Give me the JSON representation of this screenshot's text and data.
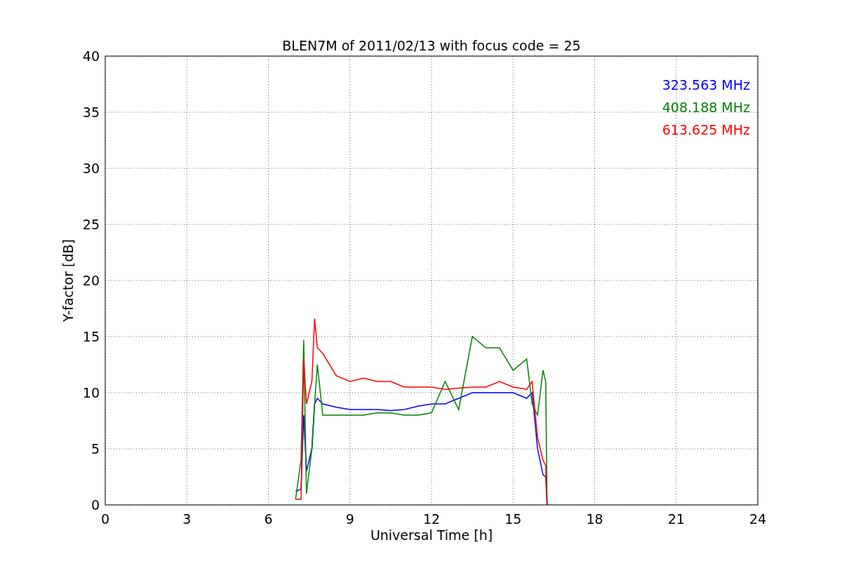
{
  "chart_data": {
    "type": "line",
    "title": "BLEN7M of 2011/02/13 with focus code = 25",
    "xlabel": "Universal Time [h]",
    "ylabel": "Y-factor [dB]",
    "x": [
      7.0,
      7.2,
      7.3,
      7.4,
      7.6,
      7.7,
      7.8,
      8.0,
      8.5,
      9.0,
      9.5,
      10.0,
      10.5,
      11.0,
      11.5,
      12.0,
      12.5,
      13.0,
      13.5,
      14.0,
      14.5,
      15.0,
      15.5,
      15.7,
      15.9,
      16.1,
      16.2,
      16.25
    ],
    "series": [
      {
        "name": "323.563 MHz",
        "color": "#0000ff",
        "values": [
          1.2,
          1.4,
          8,
          3,
          5,
          9,
          9.5,
          9,
          8.7,
          8.5,
          8.5,
          8.5,
          8.4,
          8.5,
          8.8,
          9,
          9,
          9.5,
          10,
          10,
          10,
          10,
          9.5,
          10,
          5,
          2.7,
          2.5,
          0
        ]
      },
      {
        "name": "408.188 MHz",
        "color": "#008000",
        "values": [
          0.5,
          4,
          14.7,
          1,
          5,
          9,
          12.5,
          8,
          8,
          8,
          8,
          8.2,
          8.2,
          8,
          8,
          8.2,
          11,
          8.5,
          15,
          14,
          14,
          12,
          13,
          9,
          8,
          12,
          11,
          0
        ]
      },
      {
        "name": "613.625 MHz",
        "color": "#ff0000",
        "values": [
          0.5,
          0.5,
          13,
          9,
          11,
          16.6,
          14,
          13.5,
          11.5,
          11,
          11.3,
          11,
          11,
          10.5,
          10.5,
          10.5,
          10.3,
          10.4,
          10.5,
          10.5,
          11,
          10.5,
          10.3,
          11,
          6,
          4,
          3.5,
          0
        ]
      }
    ],
    "xlim": [
      0,
      24
    ],
    "ylim": [
      0,
      40
    ],
    "xticks": [
      0,
      3,
      6,
      9,
      12,
      15,
      18,
      21,
      24
    ],
    "yticks": [
      0,
      5,
      10,
      15,
      20,
      25,
      30,
      35,
      40
    ],
    "grid": true
  }
}
